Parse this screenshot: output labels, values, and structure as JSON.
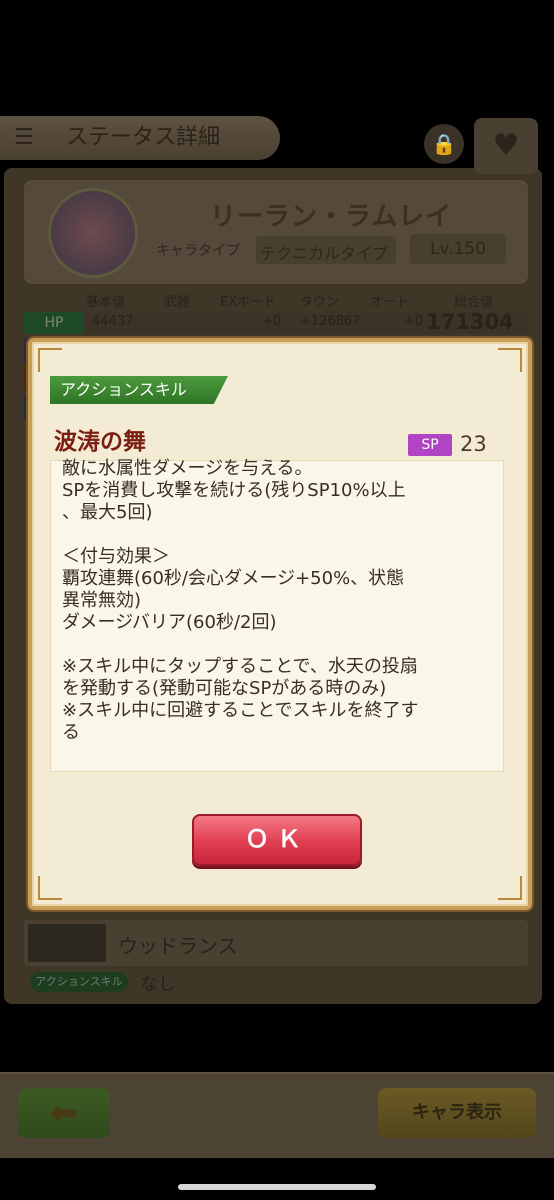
{
  "screen": {
    "title": "ステータス詳細",
    "menu_icon": "hamburger-menu-icon",
    "lock_icon": "lock-icon",
    "favorite_icon": "heart-icon"
  },
  "character": {
    "name": "リーラン・ラムレイ",
    "type_label": "キャラタイプ",
    "type_value": "テクニカルタイプ",
    "level": "Lv.150"
  },
  "stats": {
    "headers": [
      "基本値",
      "武器",
      "EXボード",
      "タウン",
      "オート",
      "総合値"
    ],
    "hp": {
      "label": "HP",
      "base": "44437",
      "ex_board": "+0",
      "town": "+126867",
      "auto": "+0",
      "total": "171304"
    }
  },
  "weapon": {
    "name": "ウッドランス",
    "skill_label": "アクションスキル",
    "skill_value": "なし"
  },
  "dialog": {
    "category": "アクションスキル",
    "skill_name": "波涛の舞",
    "sp_label": "SP",
    "sp_cost": "23",
    "description": "敵に水属性ダメージを与える。\nSPを消費し攻撃を続ける(残りSP10%以上\n、最大5回)\n\n＜付与効果＞\n覇攻連舞(60秒/会心ダメージ+50%、状態\n異常無効)\nダメージバリア(60秒/2回)\n\n※スキル中にタップすることで、水天の投扇\nを発動する(発動可能なSPがある時のみ)\n※スキル中に回避することでスキルを終了す\nる",
    "ok_label": "ＯＫ"
  },
  "footer": {
    "back_icon": "left-arrow-icon",
    "chara_view_label": "キャラ表示"
  },
  "colors": {
    "sp_badge": "#b044c4",
    "ok_button": "#e03d50",
    "ribbon": "#3f8a34",
    "skill_name": "#7a1e12"
  }
}
